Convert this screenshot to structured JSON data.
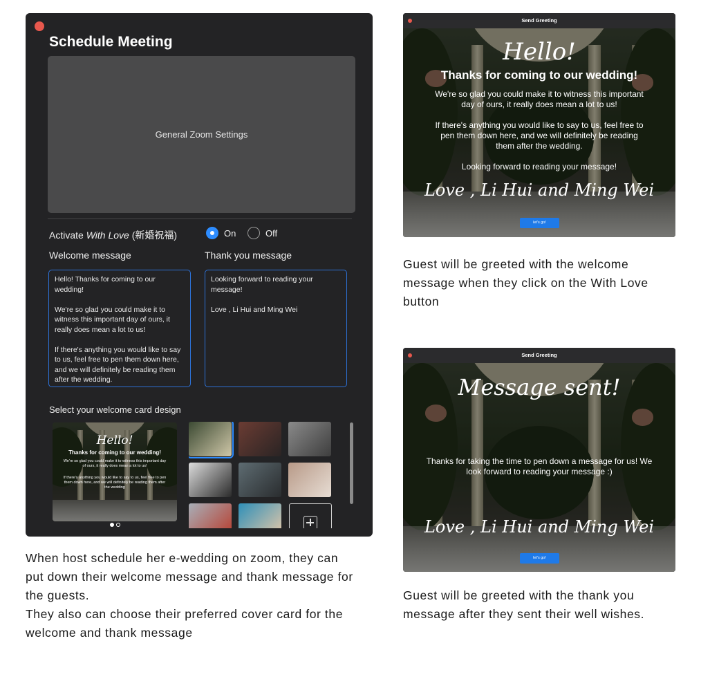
{
  "schedule": {
    "title": "Schedule Meeting",
    "general_settings": "General Zoom Settings",
    "activate": {
      "prefix": "Activate ",
      "italic": "With Love",
      "suffix": " (新婚祝福)",
      "on_label": "On",
      "off_label": "Off",
      "selected": "On"
    },
    "welcome_label": "Welcome message",
    "welcome_text": "Hello! Thanks for coming to our wedding!\n\nWe're so glad you could make it to witness this important day of ours, it really does mean a lot to us!\n\nIf there's anything you would like to say to us, feel free to pen them down here, and we will definitely be reading them after the wedding.",
    "thanks_label": "Thank you message",
    "thanks_text": "Looking forward to reading your message!\n\nLove , Li Hui and Ming Wei",
    "card_label": "Select your welcome card design",
    "preview": {
      "heading": "Hello!",
      "subheading": "Thanks for coming to our wedding!",
      "para1": "We're so glad you could make it to witness this important day of ours, it really does mean a lot to us!",
      "para2": "If there's anything you would like to say to us, feel free to pen them down here, and we will definitely be reading them after the wedding"
    },
    "carousel": {
      "pages": 2,
      "active": 1
    },
    "thumbnails": [
      {
        "name": "gazebo",
        "colors": [
          "#3c4a33",
          "#cfc7a8"
        ],
        "selected": true
      },
      {
        "name": "market",
        "colors": [
          "#6b3c33",
          "#2a2424"
        ]
      },
      {
        "name": "street",
        "colors": [
          "#8a8a8a",
          "#3e3e3e"
        ]
      },
      {
        "name": "crosswalk",
        "colors": [
          "#dcdcdc",
          "#2b2b2b"
        ]
      },
      {
        "name": "desk",
        "colors": [
          "#5e6c72",
          "#2a2d2f"
        ]
      },
      {
        "name": "couple",
        "colors": [
          "#b89a88",
          "#e7ddd4"
        ]
      },
      {
        "name": "car",
        "colors": [
          "#a8afb8",
          "#b83a2a"
        ]
      },
      {
        "name": "beach",
        "colors": [
          "#2e8fb8",
          "#e9c9a8"
        ]
      }
    ]
  },
  "greeting_window": {
    "title": "Send Greeting",
    "heading": "Hello!",
    "subheading": "Thanks for coming to our wedding!",
    "para1": "We're so glad you could make it to witness this important day of ours, it really does mean a lot to us!",
    "para2": "If there's anything you would like to say to us, feel free to pen them down here, and we will definitely be reading them after the wedding.",
    "para3": "Looking forward to reading your message!",
    "signature": "Love , Li Hui and Ming Wei",
    "button": "let's go!"
  },
  "sent_window": {
    "title": "Send Greeting",
    "heading": "Message sent!",
    "para": "Thanks for taking the time to pen down a message for us! We look forward to reading your message :)",
    "signature": "Love , Li Hui and Ming Wei",
    "button": "let's go!"
  },
  "captions": {
    "left_line1": "When host schedule her e-wedding on zoom, they can put down their welcome message and thank message for the guests.",
    "left_line2": "They also can choose their preferred cover card for the welcome and thank message",
    "right_top": "Guest will be greeted with the welcome message when they click on the With Love button",
    "right_bottom": "Guest will be greeted with the thank you message after they sent their well wishes."
  },
  "colors": {
    "accent": "#2d8cff",
    "close": "#e8584d",
    "panel": "#232325",
    "button": "#1f7ae8"
  }
}
